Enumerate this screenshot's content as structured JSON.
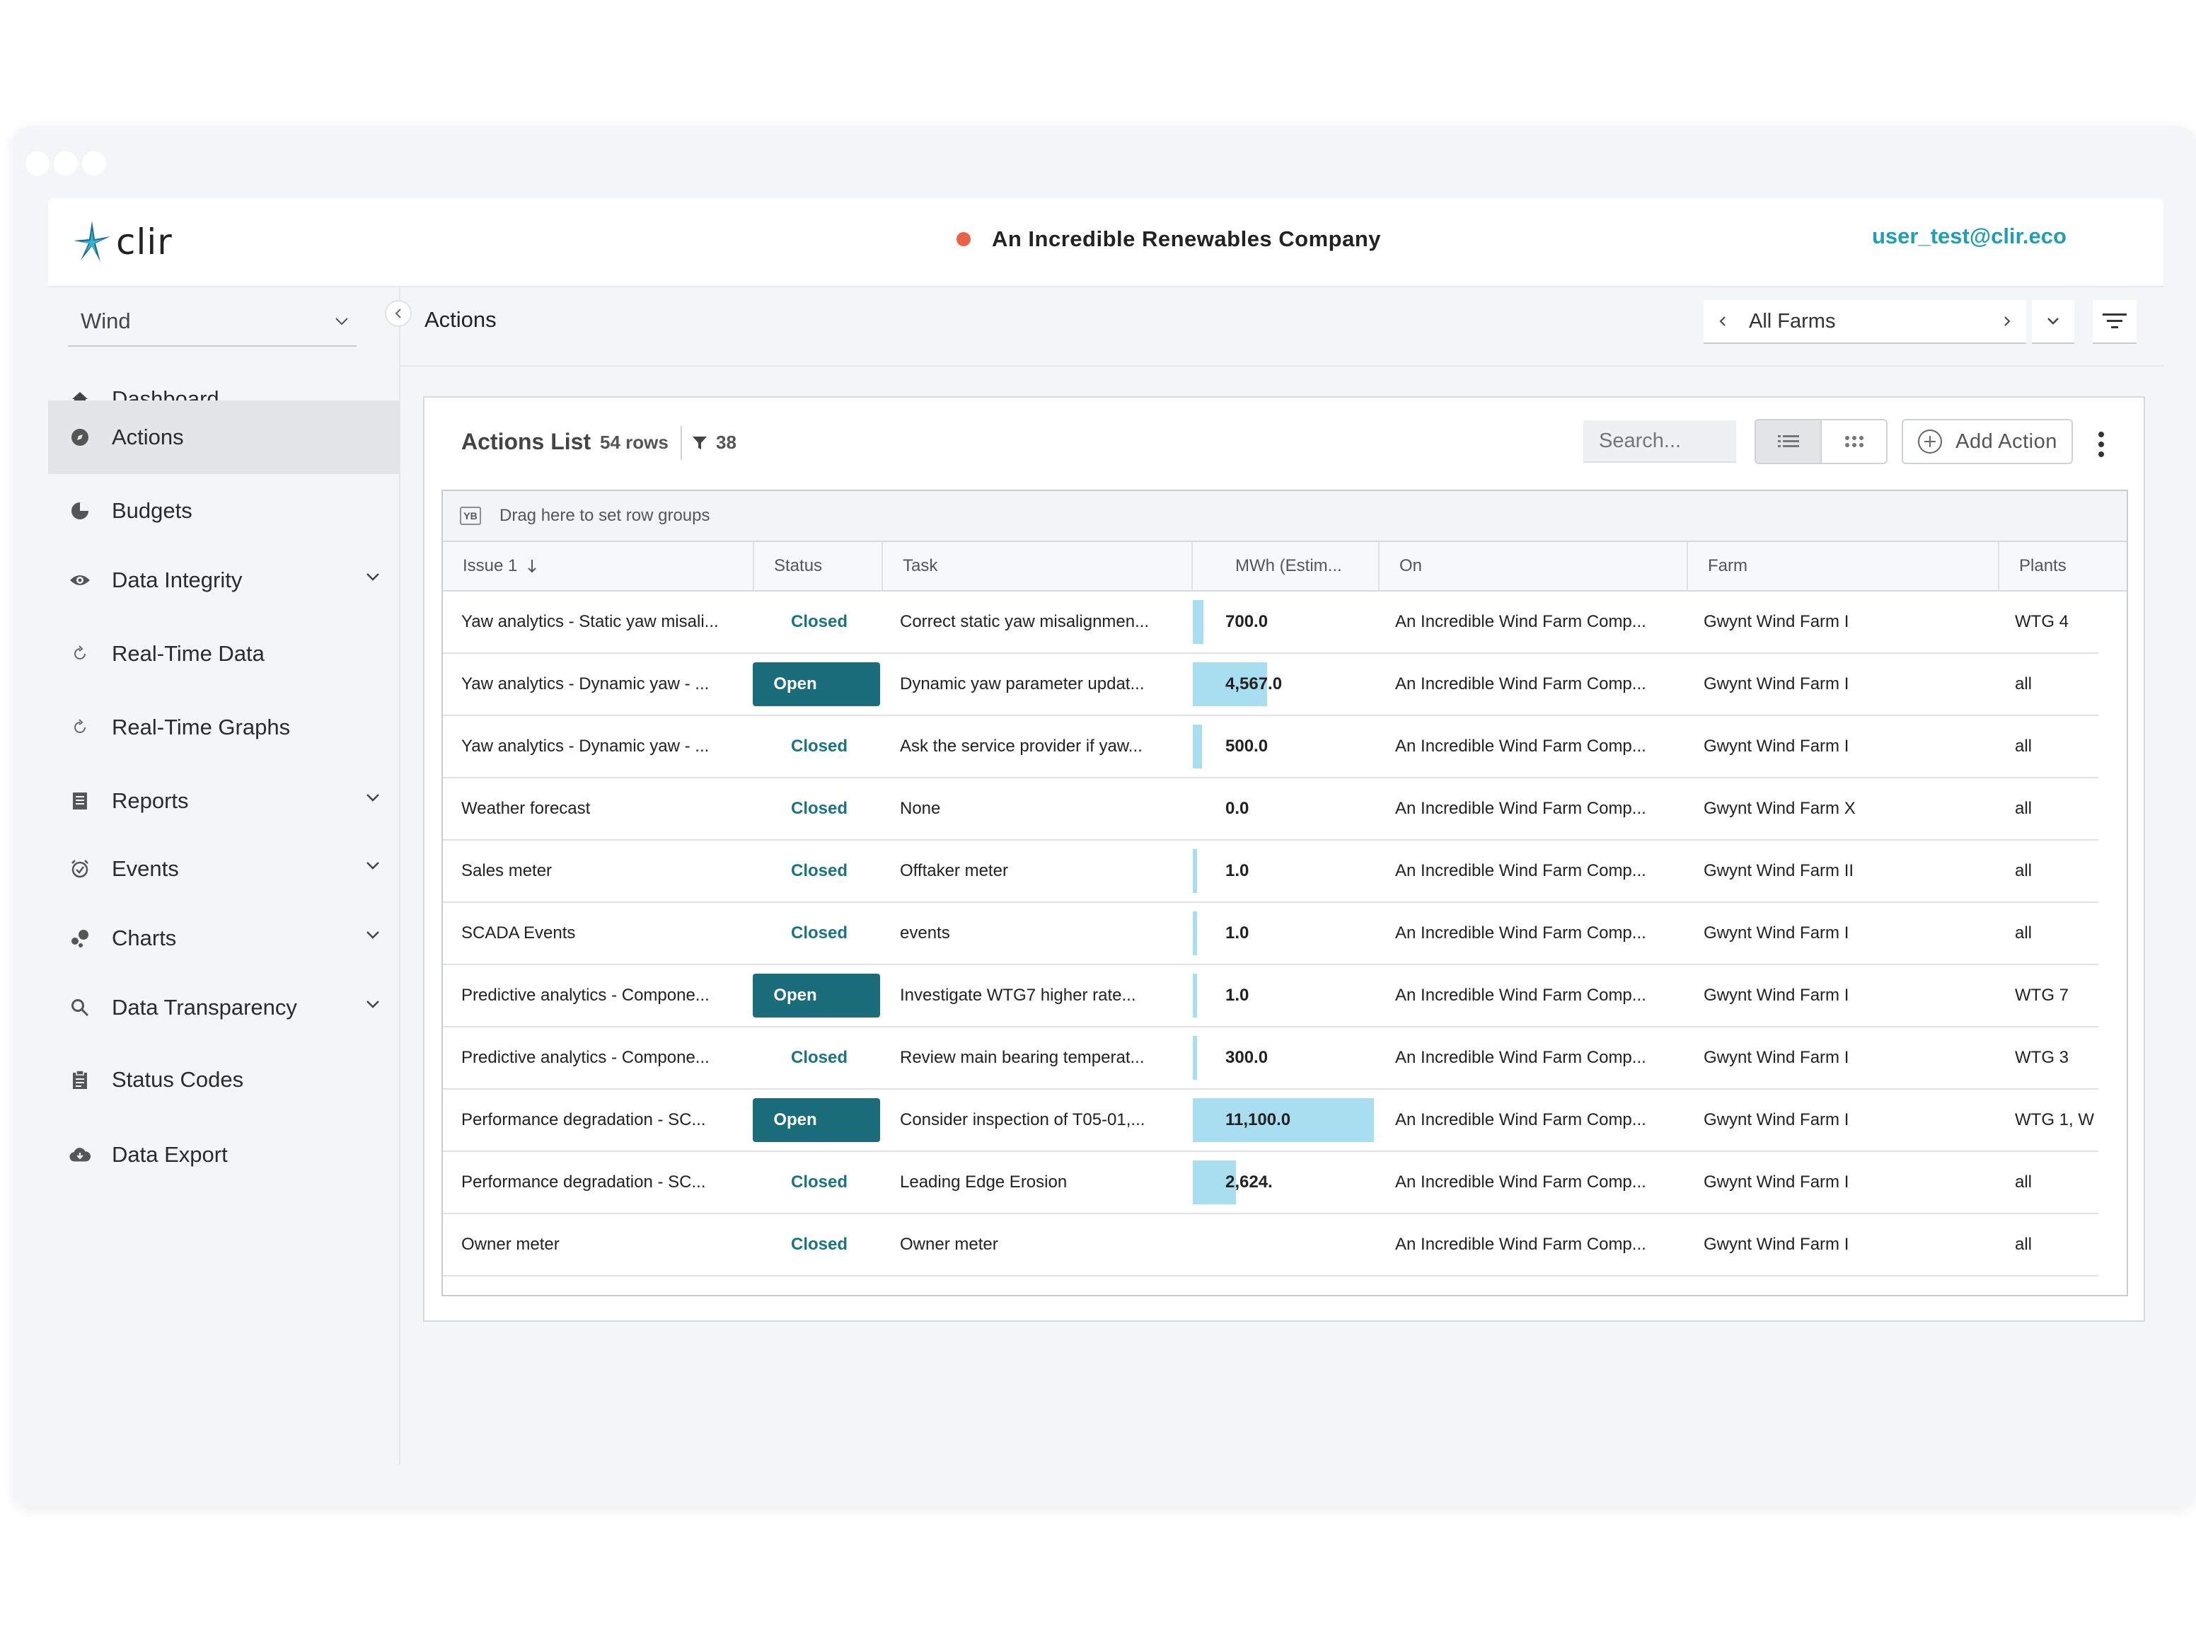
{
  "company": "An Incredible Renewables Company",
  "user": "user_test@clir.eco",
  "logo_text": "clir",
  "sector": "Wind",
  "page_title": "Actions",
  "farm_selector": "All Farms",
  "sidebar": {
    "items": [
      {
        "label": "Dashboard",
        "icon": "home-icon"
      },
      {
        "label": "Actions",
        "icon": "compass-icon",
        "active": true
      },
      {
        "label": "Budgets",
        "icon": "pie-chart-icon"
      },
      {
        "label": "Data Integrity",
        "icon": "eye-icon",
        "expandable": true
      },
      {
        "label": "Real-Time Data",
        "icon": "refresh-icon"
      },
      {
        "label": "Real-Time Graphs",
        "icon": "refresh-icon"
      },
      {
        "label": "Reports",
        "icon": "report-icon",
        "expandable": true
      },
      {
        "label": "Events",
        "icon": "alarm-icon",
        "expandable": true
      },
      {
        "label": "Charts",
        "icon": "bubbles-icon",
        "expandable": true
      },
      {
        "label": "Data Transparency",
        "icon": "search-icon",
        "expandable": true
      },
      {
        "label": "Status Codes",
        "icon": "clipboard-icon"
      },
      {
        "label": "Data Export",
        "icon": "cloud-download-icon"
      }
    ]
  },
  "card": {
    "title": "Actions List",
    "rows_count": "54 rows",
    "filter_count": "38",
    "search_placeholder": "Search...",
    "add_action": "Add Action",
    "group_bar": "Drag here to set row groups",
    "group_badge": "YB"
  },
  "columns": [
    "Issue 1",
    "Status",
    "Task",
    "MWh (Estim...",
    "On",
    "Farm",
    "Plants"
  ],
  "rows": [
    {
      "issue": "Yaw analytics - Static yaw misali...",
      "status": "Closed",
      "task": "Correct static yaw misalignmen...",
      "mwh": "700.0",
      "mwh_fraction": 0.06,
      "on": "An Incredible Wind Farm Comp...",
      "farm": "Gwynt Wind Farm I",
      "plants": "WTG 4"
    },
    {
      "issue": "Yaw analytics - Dynamic yaw - ...",
      "status": "Open",
      "task": "Dynamic yaw parameter updat...",
      "mwh": "4,567.0",
      "mwh_fraction": 0.41,
      "on": "An Incredible Wind Farm Comp...",
      "farm": "Gwynt Wind Farm I",
      "plants": "all"
    },
    {
      "issue": "Yaw analytics - Dynamic yaw - ...",
      "status": "Closed",
      "task": "Ask the service provider if yaw...",
      "mwh": "500.0",
      "mwh_fraction": 0.05,
      "on": "An Incredible Wind Farm Comp...",
      "farm": "Gwynt Wind Farm I",
      "plants": "all"
    },
    {
      "issue": "Weather forecast",
      "status": "Closed",
      "task": "None",
      "mwh": "0.0",
      "mwh_fraction": 0,
      "on": "An Incredible Wind Farm Comp...",
      "farm": "Gwynt Wind Farm X",
      "plants": "all"
    },
    {
      "issue": "Sales meter",
      "status": "Closed",
      "task": "Offtaker meter",
      "mwh": "1.0",
      "mwh_fraction": 0.01,
      "on": "An Incredible Wind Farm Comp...",
      "farm": "Gwynt Wind Farm II",
      "plants": "all"
    },
    {
      "issue": "SCADA Events",
      "status": "Closed",
      "task": "events",
      "mwh": "1.0",
      "mwh_fraction": 0.01,
      "on": "An Incredible Wind Farm Comp...",
      "farm": "Gwynt Wind Farm I",
      "plants": "all"
    },
    {
      "issue": "Predictive analytics - Compone...",
      "status": "Open",
      "task": "Investigate WTG7 higher rate...",
      "mwh": "1.0",
      "mwh_fraction": 0.01,
      "on": "An Incredible Wind Farm Comp...",
      "farm": "Gwynt Wind Farm I",
      "plants": "WTG 7"
    },
    {
      "issue": "Predictive analytics - Compone...",
      "status": "Closed",
      "task": "Review main bearing temperat...",
      "mwh": "300.0",
      "mwh_fraction": 0.01,
      "on": "An Incredible Wind Farm Comp...",
      "farm": "Gwynt Wind Farm I",
      "plants": "WTG 3"
    },
    {
      "issue": "Performance degradation - SC...",
      "status": "Open",
      "task": "Consider inspection of T05-01,...",
      "mwh": "11,100.0",
      "mwh_fraction": 1.0,
      "on": "An Incredible Wind Farm Comp...",
      "farm": "Gwynt Wind Farm I",
      "plants": "WTG 1, W"
    },
    {
      "issue": "Performance degradation - SC...",
      "status": "Closed",
      "task": "Leading Edge Erosion",
      "mwh": "2,624.",
      "mwh_fraction": 0.24,
      "on": "An Incredible Wind Farm Comp...",
      "farm": "Gwynt Wind Farm I",
      "plants": "all"
    },
    {
      "issue": "Owner meter",
      "status": "Closed",
      "task": "Owner meter",
      "mwh": "",
      "mwh_fraction": 0,
      "on": "An Incredible Wind Farm Comp...",
      "farm": "Gwynt Wind Farm I",
      "plants": "all"
    }
  ],
  "colors": {
    "accent": "#1f9fb1",
    "open_badge": "#1b6d7c",
    "status_dot": "#e8624a",
    "bar": "#a9def0"
  }
}
